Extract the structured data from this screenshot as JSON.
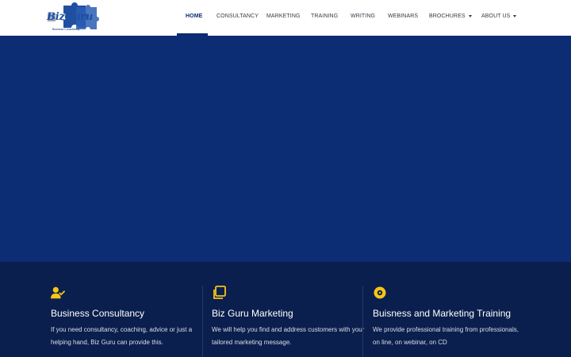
{
  "brand": {
    "name": "BizGuru",
    "tagline": "Business Consultancy",
    "colors": {
      "primary": "#0b2a72",
      "dark": "#0a1f4d",
      "accent": "#f5c518"
    }
  },
  "nav": {
    "items": [
      {
        "label": "HOME",
        "active": true
      },
      {
        "label": "CONSULTANCY"
      },
      {
        "label": "MARKETING"
      },
      {
        "label": "TRAINING"
      },
      {
        "label": "WRITING"
      },
      {
        "label": "WEBINARS"
      },
      {
        "label": "BROCHURES",
        "dropdown": true
      },
      {
        "label": "ABOUT US",
        "dropdown": true
      }
    ]
  },
  "features": [
    {
      "icon": "user-check-icon",
      "title": "Business Consultancy",
      "text": "If you need consultancy, coaching, advice or just a helping hand, Biz Guru can provide this."
    },
    {
      "icon": "copy-icon",
      "title": "Biz Guru Marketing",
      "text": "We will help you find and address customers with your tailored marketing message."
    },
    {
      "icon": "disc-icon",
      "title": "Buisness and Marketing Training",
      "text": "We provide professional training from professionals, on line, on webinar, on CD"
    }
  ]
}
